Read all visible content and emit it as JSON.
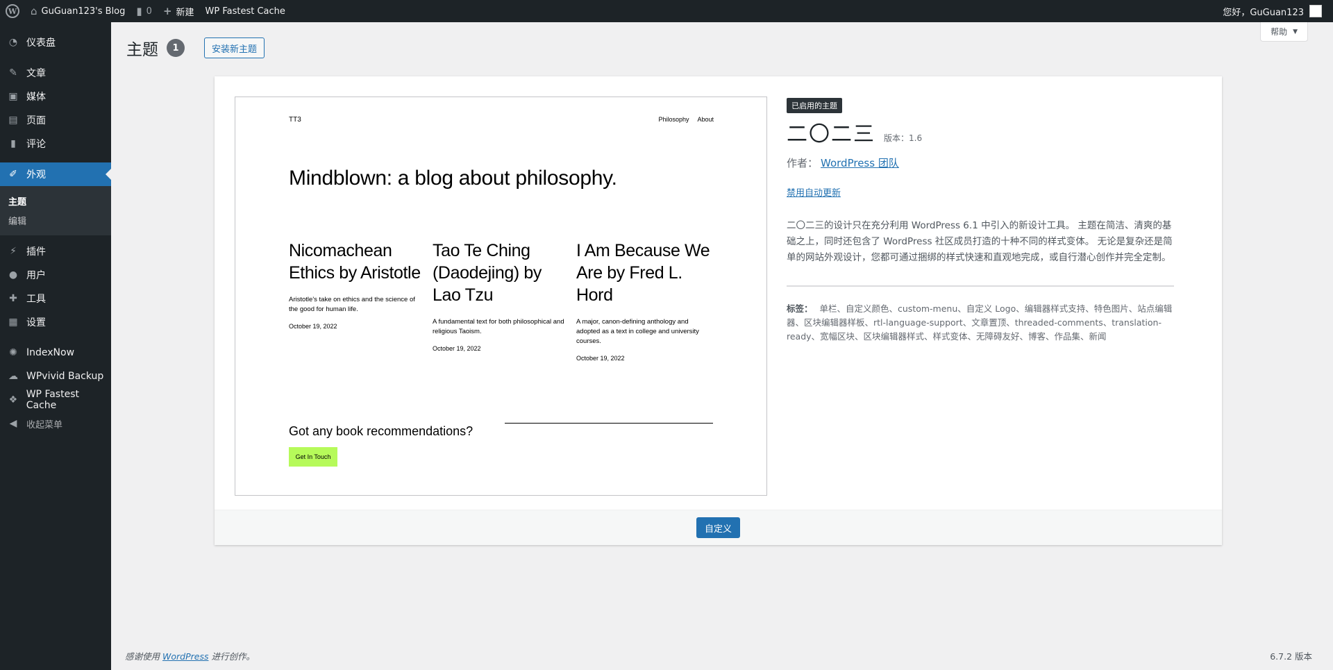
{
  "adminbar": {
    "site_name": "GuGuan123's Blog",
    "comments_count": "0",
    "new_label": "新建",
    "plugin_label": "WP Fastest Cache",
    "greeting": "您好，GuGuan123"
  },
  "sidebar": {
    "items": [
      {
        "label": "仪表盘",
        "icon": "dashboard-icon"
      },
      {
        "label": "文章",
        "icon": "pushpin-icon"
      },
      {
        "label": "媒体",
        "icon": "media-icon"
      },
      {
        "label": "页面",
        "icon": "page-icon"
      },
      {
        "label": "评论",
        "icon": "comment-icon"
      },
      {
        "label": "外观",
        "icon": "paintbrush-icon"
      },
      {
        "label": "插件",
        "icon": "plugin-icon"
      },
      {
        "label": "用户",
        "icon": "user-icon"
      },
      {
        "label": "工具",
        "icon": "wrench-icon"
      },
      {
        "label": "设置",
        "icon": "settings-icon"
      },
      {
        "label": "IndexNow",
        "icon": "gear-icon"
      },
      {
        "label": "WPvivid Backup",
        "icon": "cloud-icon"
      },
      {
        "label": "WP Fastest Cache",
        "icon": "cheetah-icon"
      }
    ],
    "submenu": [
      "主题",
      "编辑"
    ],
    "collapse_label": "收起菜单"
  },
  "header": {
    "title": "主题",
    "count": "1",
    "add_new_label": "安装新主题",
    "help_label": "帮助"
  },
  "preview": {
    "site_title": "TT3",
    "nav": [
      "Philosophy",
      "About"
    ],
    "hero": "Mindblown: a blog about philosophy.",
    "posts": [
      {
        "title": "Nicomachean Ethics by Aristotle",
        "excerpt": "Aristotle's take on ethics and the science of the good for human life.",
        "date": "October 19, 2022"
      },
      {
        "title": "Tao Te Ching (Daodejing) by Lao Tzu",
        "excerpt": "A fundamental text for both philosophical and religious Taoism.",
        "date": "October 19, 2022"
      },
      {
        "title": "I Am Because We Are by Fred L. Hord",
        "excerpt": "A major, canon-defining anthology and adopted as a text in college and university courses.",
        "date": "October 19, 2022"
      }
    ],
    "cta": "Got any book recommendations?",
    "button": "Get In Touch"
  },
  "theme": {
    "active_badge": "已启用的主题",
    "name": "二〇二三",
    "version": "版本：1.6",
    "author_prefix": "作者：",
    "author": "WordPress 团队",
    "auto_update": "禁用自动更新",
    "description": "二〇二三的设计只在充分利用 WordPress 6.1 中引入的新设计工具。 主题在简洁、清爽的基础之上，同时还包含了 WordPress 社区成员打造的十种不同的样式变体。 无论是复杂还是简单的网站外观设计，您都可通过捆绑的样式快速和直观地完成，或自行潜心创作并完全定制。",
    "tags_label": "标签：",
    "tags": "单栏、自定义颜色、custom-menu、自定义 Logo、编辑器样式支持、特色图片、站点编辑器、区块编辑器样板、rtl-language-support、文章置顶、threaded-comments、translation-ready、宽幅区块、区块编辑器样式、样式变体、无障碍友好、博客、作品集、新闻",
    "customize_label": "自定义"
  },
  "footer": {
    "thanks_prefix": "感谢使用",
    "wp_link": "WordPress",
    "thanks_suffix": "进行创作。",
    "version": "6.7.2 版本"
  }
}
